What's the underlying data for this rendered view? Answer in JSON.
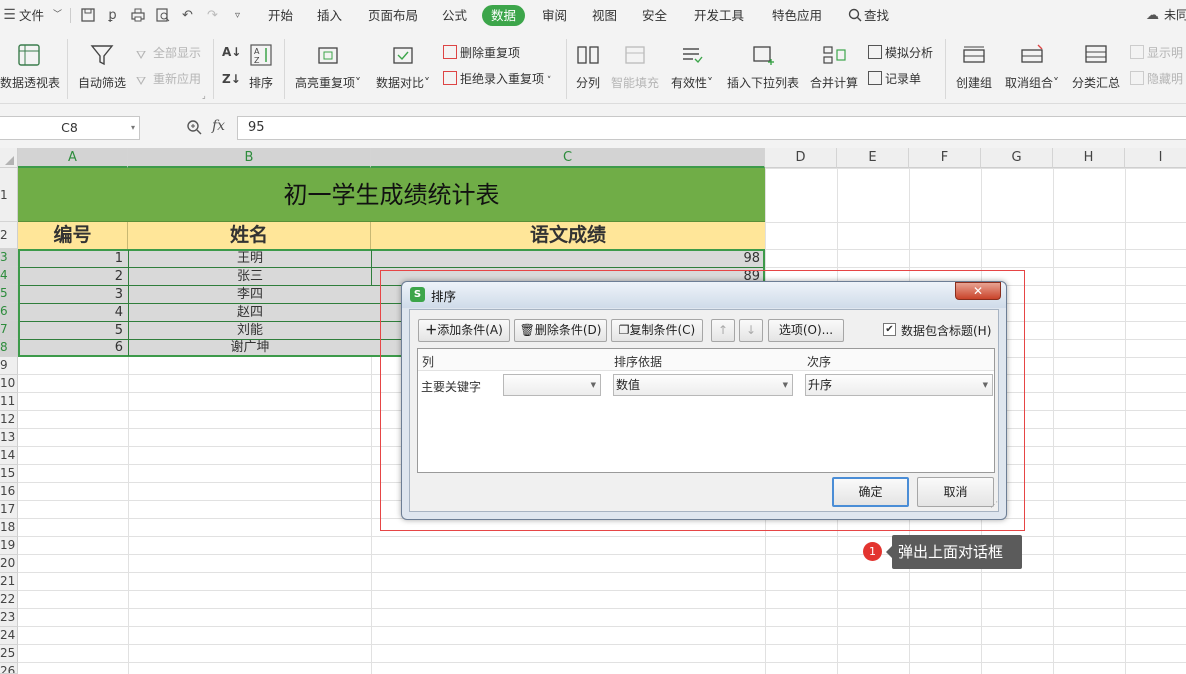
{
  "menubar": {
    "file": "文件",
    "tabs": [
      "开始",
      "插入",
      "页面布局",
      "公式",
      "数据",
      "审阅",
      "视图",
      "安全",
      "开发工具",
      "特色应用"
    ],
    "active_tab": "数据",
    "search": "查找",
    "account": "未同"
  },
  "ribbon": {
    "pivot": "数据透视表",
    "autofilter": "自动筛选",
    "show_all": "全部显示",
    "reapply": "重新应用",
    "sort": "排序",
    "highlight_dup": "高亮重复项",
    "data_compare": "数据对比",
    "remove_dup": "删除重复项",
    "reject_dup": "拒绝录入重复项",
    "split": "分列",
    "smart_fill": "智能填充",
    "validity": "有效性",
    "insert_dropdown": "插入下拉列表",
    "merge_calc": "合并计算",
    "what_if": "模拟分析",
    "record": "记录单",
    "create_group": "创建组",
    "ungroup": "取消组合",
    "subtotal": "分类汇总",
    "show_detail": "显示明",
    "hide_detail": "隐藏明"
  },
  "formula_bar": {
    "cell_ref": "C8",
    "fx": "fx",
    "value": "95"
  },
  "sheet": {
    "columns": [
      "A",
      "B",
      "C",
      "D",
      "E",
      "F",
      "G",
      "H",
      "I"
    ],
    "rows": [
      "1",
      "2",
      "3",
      "4",
      "5",
      "6",
      "7",
      "8",
      "9",
      "10",
      "11",
      "12",
      "13",
      "14",
      "15",
      "16",
      "17",
      "18",
      "19",
      "20",
      "21",
      "22",
      "23",
      "24",
      "25",
      "26"
    ],
    "title": "初一学生成绩统计表",
    "headers": [
      "编号",
      "姓名",
      "语文成绩"
    ],
    "data": [
      {
        "id": "1",
        "name": "王明",
        "score": "98"
      },
      {
        "id": "2",
        "name": "张三",
        "score": "89"
      },
      {
        "id": "3",
        "name": "李四",
        "score": ""
      },
      {
        "id": "4",
        "name": "赵四",
        "score": ""
      },
      {
        "id": "5",
        "name": "刘能",
        "score": ""
      },
      {
        "id": "6",
        "name": "谢广坤",
        "score": ""
      }
    ]
  },
  "dialog": {
    "title": "排序",
    "add_condition": "添加条件(A)",
    "delete_condition": "删除条件(D)",
    "copy_condition": "复制条件(C)",
    "options": "选项(O)...",
    "has_header": "数据包含标题(H)",
    "has_header_checked": true,
    "col_header": "列",
    "basis_header": "排序依据",
    "order_header": "次序",
    "primary_key": "主要关键字",
    "primary_value": "",
    "basis_value": "数值",
    "order_value": "升序",
    "ok": "确定",
    "cancel": "取消"
  },
  "annotation": {
    "badge": "1",
    "text": "弹出上面对话框"
  },
  "colors": {
    "accent": "#3ca54a",
    "title_fill": "#70ad47",
    "header_fill": "#ffe699",
    "selection_fill": "#d9d9d9",
    "annotation_red": "#e3342f"
  }
}
